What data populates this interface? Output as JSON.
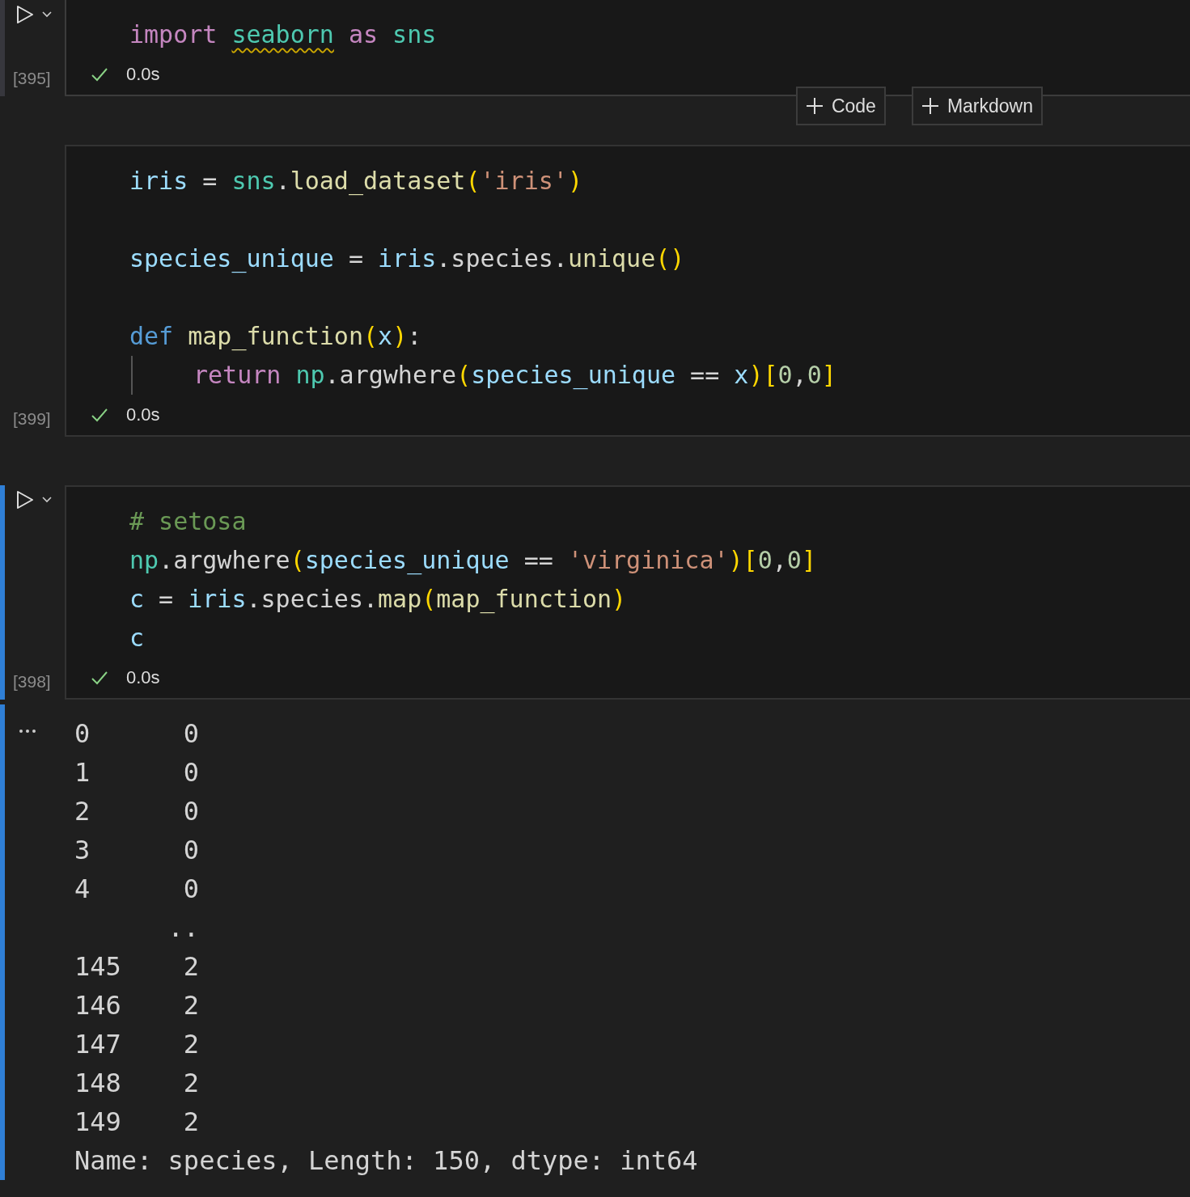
{
  "cells": [
    {
      "kind": "code",
      "hovered": true,
      "focused": false,
      "run_visible": true,
      "execution_count": "[395]",
      "succeeded": true,
      "duration": "0.0s",
      "lines": [
        {
          "tokens": [
            {
              "t": "import ",
              "kind": "keyword"
            },
            {
              "t": "seaborn",
              "kind": "module",
              "warning": true
            },
            {
              "t": " as",
              "kind": "keyword"
            },
            {
              "t": " sns",
              "kind": "module"
            }
          ]
        }
      ],
      "insert_after": [
        "Code",
        "Markdown"
      ]
    },
    {
      "kind": "code",
      "hovered": false,
      "focused": false,
      "run_visible": false,
      "execution_count": "[399]",
      "succeeded": true,
      "duration": "0.0s",
      "lines": [
        {
          "tokens": [
            {
              "t": "iris",
              "kind": "variable"
            },
            {
              "t": " = ",
              "kind": "plain"
            },
            {
              "t": "sns",
              "kind": "module"
            },
            {
              "t": ".",
              "kind": "plain"
            },
            {
              "t": "load_dataset",
              "kind": "function"
            },
            {
              "t": "(",
              "kind": "bracket"
            },
            {
              "t": "'iris'",
              "kind": "string"
            },
            {
              "t": ")",
              "kind": "bracket"
            }
          ]
        },
        {
          "space_before": true,
          "tokens": [
            {
              "t": "species_unique",
              "kind": "variable"
            },
            {
              "t": " = ",
              "kind": "plain"
            },
            {
              "t": "iris",
              "kind": "variable"
            },
            {
              "t": ".species.",
              "kind": "plain"
            },
            {
              "t": "unique",
              "kind": "function"
            },
            {
              "t": "()",
              "kind": "bracket"
            }
          ]
        },
        {
          "space_before": true,
          "tokens": [
            {
              "t": "def ",
              "kind": "storage"
            },
            {
              "t": "map_function",
              "kind": "function"
            },
            {
              "t": "(",
              "kind": "bracket"
            },
            {
              "t": "x",
              "kind": "variable"
            },
            {
              "t": ")",
              "kind": "bracket"
            },
            {
              "t": ":",
              "kind": "plain"
            }
          ],
          "children": [
            {
              "tokens": [
                {
                  "t": "return ",
                  "kind": "keyword"
                },
                {
                  "t": "np",
                  "kind": "module"
                },
                {
                  "t": ".argwhere",
                  "kind": "plain"
                },
                {
                  "t": "(",
                  "kind": "bracket"
                },
                {
                  "t": "species_unique",
                  "kind": "variable"
                },
                {
                  "t": " == ",
                  "kind": "plain"
                },
                {
                  "t": "x",
                  "kind": "variable"
                },
                {
                  "t": ")[",
                  "kind": "bracket"
                },
                {
                  "t": "0",
                  "kind": "number"
                },
                {
                  "t": ",",
                  "kind": "plain"
                },
                {
                  "t": "0",
                  "kind": "number"
                },
                {
                  "t": "]",
                  "kind": "bracket"
                }
              ]
            }
          ]
        }
      ]
    },
    {
      "kind": "code",
      "hovered": false,
      "focused": true,
      "run_visible": true,
      "execution_count": "[398]",
      "succeeded": true,
      "duration": "0.0s",
      "lines": [
        {
          "tokens": [
            {
              "t": "# setosa",
              "kind": "comment"
            }
          ]
        },
        {
          "tokens": [
            {
              "t": "np",
              "kind": "module"
            },
            {
              "t": ".argwhere",
              "kind": "plain"
            },
            {
              "t": "(",
              "kind": "bracket"
            },
            {
              "t": "species_unique",
              "kind": "variable"
            },
            {
              "t": " == ",
              "kind": "plain"
            },
            {
              "t": "'virginica'",
              "kind": "string"
            },
            {
              "t": ")[",
              "kind": "bracket"
            },
            {
              "t": "0",
              "kind": "number"
            },
            {
              "t": ",",
              "kind": "plain"
            },
            {
              "t": "0",
              "kind": "number"
            },
            {
              "t": "]",
              "kind": "bracket"
            }
          ]
        },
        {
          "tokens": [
            {
              "t": "c",
              "kind": "variable"
            },
            {
              "t": " = ",
              "kind": "plain"
            },
            {
              "t": "iris",
              "kind": "variable"
            },
            {
              "t": ".species.",
              "kind": "plain"
            },
            {
              "t": "map",
              "kind": "function"
            },
            {
              "t": "(",
              "kind": "bracket"
            },
            {
              "t": "map_function",
              "kind": "function"
            },
            {
              "t": ")",
              "kind": "bracket"
            }
          ]
        },
        {
          "tokens": [
            {
              "t": "c",
              "kind": "variable"
            }
          ]
        }
      ],
      "output": {
        "focused": true,
        "lines": [
          "0      0",
          "1      0",
          "2      0",
          "3      0",
          "4      0",
          "      ..",
          "145    2",
          "146    2",
          "147    2",
          "148    2",
          "149    2",
          "Name: species, Length: 150, dtype: int64"
        ]
      }
    }
  ]
}
